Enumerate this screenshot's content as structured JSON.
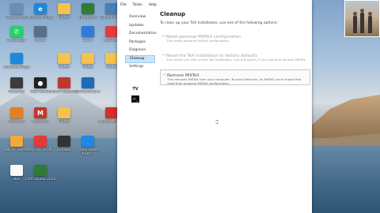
{
  "desktop": {
    "icons": [
      {
        "label": "Recycle Bin",
        "color": "#6b8fb3",
        "glyph": ""
      },
      {
        "label": "Microsoft Edge",
        "color": "#1e88d9",
        "glyph": "e"
      },
      {
        "label": "Folder",
        "color": "#f4c24d",
        "glyph": ""
      },
      {
        "label": "Phonelink",
        "color": "#2e7d32",
        "glyph": ""
      },
      {
        "label": "Control Panel",
        "color": "#4a7fb5",
        "glyph": ""
      },
      {
        "label": "WhatsApp",
        "color": "#25d366",
        "glyph": "✆"
      },
      {
        "label": "Pascal",
        "color": "#5a6f8c",
        "glyph": ""
      },
      {
        "label": "Docs",
        "color": "#2f7bd6",
        "glyph": ""
      },
      {
        "label": "AnyDesk",
        "color": "#e23d3d",
        "glyph": ""
      },
      {
        "label": "Microsoft Edge",
        "color": "#1e88d9",
        "glyph": ""
      },
      {
        "label": "Folder",
        "color": "#f4c24d",
        "glyph": ""
      },
      {
        "label": "Folder",
        "color": "#f4c24d",
        "glyph": ""
      },
      {
        "label": "Folder",
        "color": "#f4c24d",
        "glyph": ""
      },
      {
        "label": "OBS Studio",
        "color": "#222222",
        "glyph": "●"
      },
      {
        "label": "Macro Recorder",
        "color": "#c0392b",
        "glyph": ""
      },
      {
        "label": "Infrastructure",
        "color": "#1e6bb8",
        "glyph": ""
      },
      {
        "label": "Recorder",
        "color": "#3c3c3c",
        "glyph": ""
      },
      {
        "label": "Recorder",
        "color": "#e67e22",
        "glyph": ""
      },
      {
        "label": "Recorder",
        "color": "#c0392b",
        "glyph": "M"
      },
      {
        "label": "Folder",
        "color": "#f4c24d",
        "glyph": ""
      },
      {
        "label": "Adobe Acrobat",
        "color": "#d32f2f",
        "glyph": ""
      },
      {
        "label": "how_to_insert...",
        "color": "#f2a93b",
        "glyph": ""
      },
      {
        "label": "Any PDF to JPG",
        "color": "#e53935",
        "glyph": ""
      },
      {
        "label": "Installer",
        "color": "#333333",
        "glyph": ""
      },
      {
        "label": "Quick Share from...",
        "color": "#1e88e5",
        "glyph": ""
      },
      {
        "label": "Doc",
        "color": "#fafafa",
        "glyph": ""
      },
      {
        "label": "Cam Studio 2022",
        "color": "#2e7d32",
        "glyph": ""
      }
    ]
  },
  "window": {
    "menu": [
      "File",
      "Tasks",
      "Help"
    ],
    "nav": [
      {
        "label": "Overview",
        "active": false
      },
      {
        "label": "Updates",
        "active": false
      },
      {
        "label": "Documentation",
        "active": false
      },
      {
        "label": "Packages",
        "active": false
      },
      {
        "label": "Diagnose",
        "active": false
      },
      {
        "label": "Cleanup",
        "active": true
      },
      {
        "label": "Settings",
        "active": false
      }
    ],
    "title": "Cleanup",
    "intro": "To clean up your TeX installation, use one of the following options:",
    "options": [
      {
        "title": "Reset personal MiKTeX configuration",
        "desc": "This resets personal MiKTeX configuration.",
        "hover": false
      },
      {
        "title": "Reset the TeX installation to factory defaults",
        "desc": "This leaves you with a fresh TeX installation. Use this option, if you intend to reinstall MiKTeX.",
        "hover": false
      },
      {
        "title": "Remove MiKTeX",
        "desc": "This removes MiKTeX from your computer. To avoid leftovers, all MiKTeX users should first reset their personal MiKTeX configuration.",
        "hover": true
      }
    ],
    "mini_icons": [
      "TV",
      ">_"
    ]
  }
}
